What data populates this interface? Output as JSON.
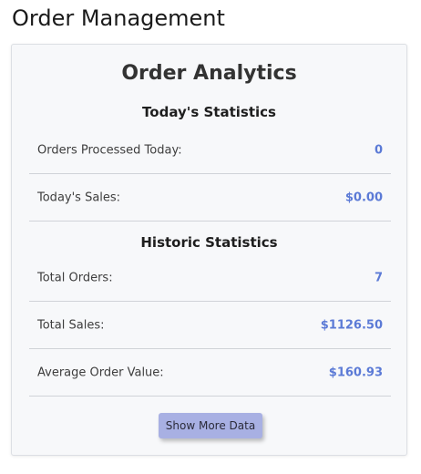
{
  "page": {
    "title": "Order Management"
  },
  "card": {
    "title": "Order Analytics",
    "today": {
      "title": "Today's Statistics",
      "rows": [
        {
          "label": "Orders Processed Today:",
          "value": "0"
        },
        {
          "label": "Today's Sales:",
          "value": "$0.00"
        }
      ]
    },
    "historic": {
      "title": "Historic Statistics",
      "rows": [
        {
          "label": "Total Orders:",
          "value": "7"
        },
        {
          "label": "Total Sales:",
          "value": "$1126.50"
        },
        {
          "label": "Average Order Value:",
          "value": "$160.93"
        }
      ]
    },
    "more_button_label": "Show More Data"
  },
  "colors": {
    "value_accent": "#5b7ad6",
    "button_bg": "#a8b0e3",
    "card_bg": "#f7f8fa"
  }
}
